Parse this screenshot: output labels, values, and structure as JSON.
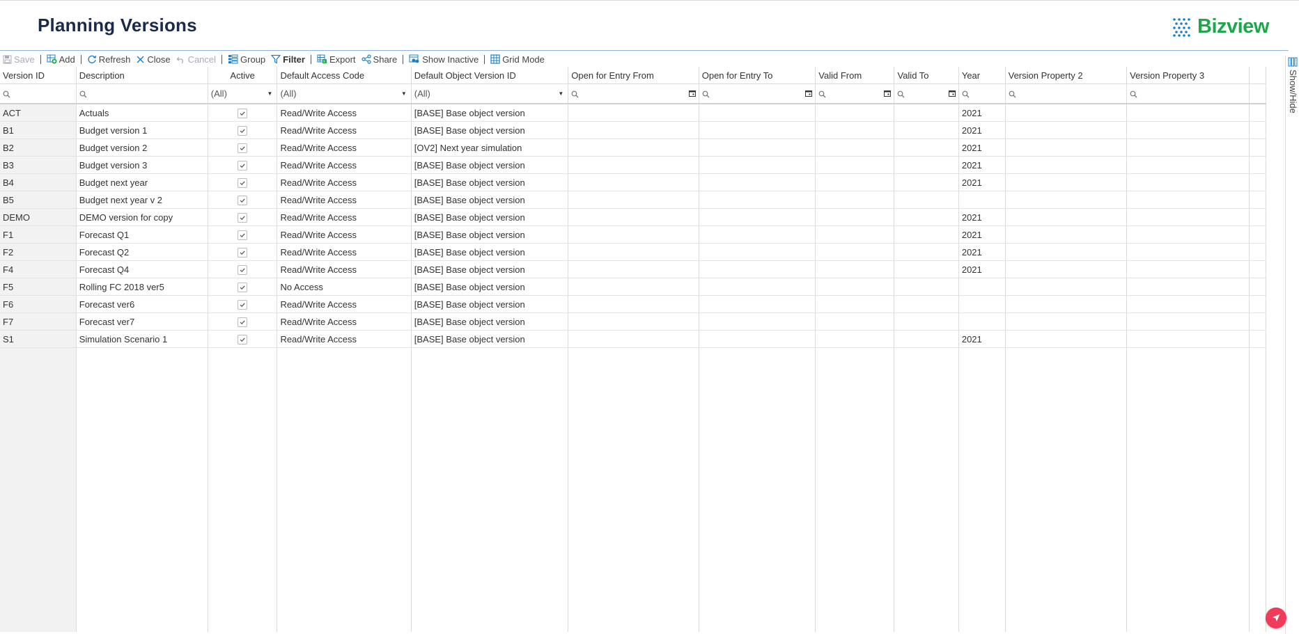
{
  "page": {
    "title": "Planning Versions"
  },
  "brand": {
    "name": "Bizview",
    "color": "#1aa84a"
  },
  "toolbar": {
    "save": "Save",
    "add": "Add",
    "refresh": "Refresh",
    "close": "Close",
    "cancel": "Cancel",
    "group": "Group",
    "filter": "Filter",
    "export": "Export",
    "share": "Share",
    "show_inactive": "Show Inactive",
    "grid_mode": "Grid Mode"
  },
  "columns": [
    "Version ID",
    "Description",
    "Active",
    "Default Access Code",
    "Default Object Version ID",
    "Open for Entry From",
    "Open for Entry To",
    "Valid From",
    "Valid To",
    "Year",
    "Version Property 2",
    "Version Property 3"
  ],
  "filters": {
    "active": "(All)",
    "access_code": "(All)",
    "object_version": "(All)"
  },
  "rows": [
    {
      "id": "ACT",
      "description": "Actuals",
      "active": true,
      "access": "Read/Write Access",
      "object_version": "[BASE] Base object version",
      "year": "2021"
    },
    {
      "id": "B1",
      "description": "Budget version 1",
      "active": true,
      "access": "Read/Write Access",
      "object_version": "[BASE] Base object version",
      "year": "2021"
    },
    {
      "id": "B2",
      "description": "Budget version 2",
      "active": true,
      "access": "Read/Write Access",
      "object_version": "[OV2] Next year simulation",
      "year": "2021"
    },
    {
      "id": "B3",
      "description": "Budget version 3",
      "active": true,
      "access": "Read/Write Access",
      "object_version": "[BASE] Base object version",
      "year": "2021"
    },
    {
      "id": "B4",
      "description": "Budget next year",
      "active": true,
      "access": "Read/Write Access",
      "object_version": "[BASE] Base object version",
      "year": "2021"
    },
    {
      "id": "B5",
      "description": "Budget next year v 2",
      "active": true,
      "access": "Read/Write Access",
      "object_version": "[BASE] Base object version",
      "year": ""
    },
    {
      "id": "DEMO",
      "description": "DEMO version for copy",
      "active": true,
      "access": "Read/Write Access",
      "object_version": "[BASE] Base object version",
      "year": "2021"
    },
    {
      "id": "F1",
      "description": "Forecast Q1",
      "active": true,
      "access": "Read/Write Access",
      "object_version": "[BASE] Base object version",
      "year": "2021"
    },
    {
      "id": "F2",
      "description": "Forecast Q2",
      "active": true,
      "access": "Read/Write Access",
      "object_version": "[BASE] Base object version",
      "year": "2021"
    },
    {
      "id": "F4",
      "description": "Forecast Q4",
      "active": true,
      "access": "Read/Write Access",
      "object_version": "[BASE] Base object version",
      "year": "2021"
    },
    {
      "id": "F5",
      "description": "Rolling FC 2018 ver5",
      "active": true,
      "access": "No Access",
      "object_version": "[BASE] Base object version",
      "year": ""
    },
    {
      "id": "F6",
      "description": "Forecast ver6",
      "active": true,
      "access": "Read/Write Access",
      "object_version": "[BASE] Base object version",
      "year": ""
    },
    {
      "id": "F7",
      "description": "Forecast ver7",
      "active": true,
      "access": "Read/Write Access",
      "object_version": "[BASE] Base object version",
      "year": ""
    },
    {
      "id": "S1",
      "description": "Simulation Scenario 1",
      "active": true,
      "access": "Read/Write Access",
      "object_version": "[BASE] Base object version",
      "year": "2021"
    }
  ],
  "side_panel": {
    "label": "Show/Hide"
  },
  "icons": {
    "save": "save-icon",
    "add": "add-icon",
    "refresh": "refresh-icon",
    "close": "close-icon",
    "cancel": "undo-icon",
    "group": "group-icon",
    "filter": "filter-icon",
    "export": "export-icon",
    "share": "share-icon",
    "show_inactive": "show-inactive-icon",
    "grid_mode": "grid-icon",
    "search": "search-icon",
    "calendar": "calendar-icon",
    "checkbox": "checkmark-icon",
    "assistant": "navigation-arrow-icon"
  },
  "colors": {
    "accent": "#1a7fc4",
    "fab": "#ef3c5a",
    "title": "#1b2a4a"
  }
}
